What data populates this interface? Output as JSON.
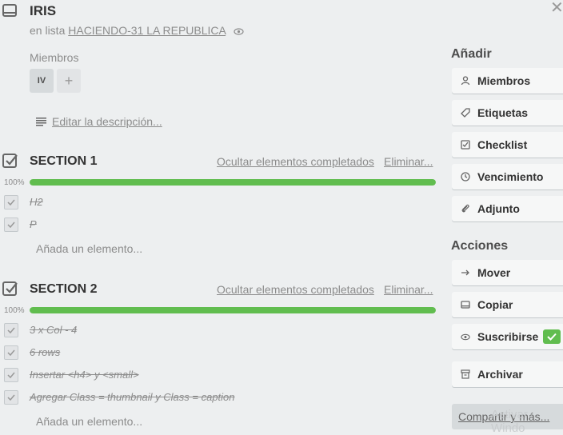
{
  "card": {
    "title": "IRIS",
    "list_prefix": "en lista",
    "list_name": "HACIENDO-31 LA REPUBLICA"
  },
  "members": {
    "label": "Miembros",
    "avatar_initials": "IV",
    "add_symbol": "+"
  },
  "description": {
    "edit_label": "Editar la descripción..."
  },
  "checklists": [
    {
      "title": "SECTION 1",
      "hide_label": "Ocultar elementos completados",
      "delete_label": "Eliminar...",
      "percent_label": "100%",
      "progress": 1.0,
      "items": [
        "H2",
        "P"
      ],
      "add_label": "Añada un elemento..."
    },
    {
      "title": "SECTION 2",
      "hide_label": "Ocultar elementos completados",
      "delete_label": "Eliminar...",
      "percent_label": "100%",
      "progress": 1.0,
      "items": [
        "3 x Col - 4",
        "6 rows",
        "Insertar <h4> y <small>",
        "Agregar Class = thumbnail y Class = caption"
      ],
      "add_label": "Añada un elemento..."
    }
  ],
  "sidebar": {
    "add_heading": "Añadir",
    "add_buttons": [
      {
        "label": "Miembros",
        "icon": "person-icon"
      },
      {
        "label": "Etiquetas",
        "icon": "tag-icon"
      },
      {
        "label": "Checklist",
        "icon": "checkbox-icon"
      },
      {
        "label": "Vencimiento",
        "icon": "clock-icon"
      },
      {
        "label": "Adjunto",
        "icon": "paperclip-icon"
      }
    ],
    "actions_heading": "Acciones",
    "action_buttons": [
      {
        "label": "Mover",
        "icon": "arrow-right-icon"
      },
      {
        "label": "Copiar",
        "icon": "card-icon"
      },
      {
        "label": "Suscribirse",
        "icon": "eye-icon"
      },
      {
        "label": "Archivar",
        "icon": "archive-icon"
      }
    ],
    "share_label": "Compartir y más..."
  },
  "watermark": "Activar Windo",
  "colors": {
    "progress": "#61bd4f",
    "background": "#edeff0"
  }
}
